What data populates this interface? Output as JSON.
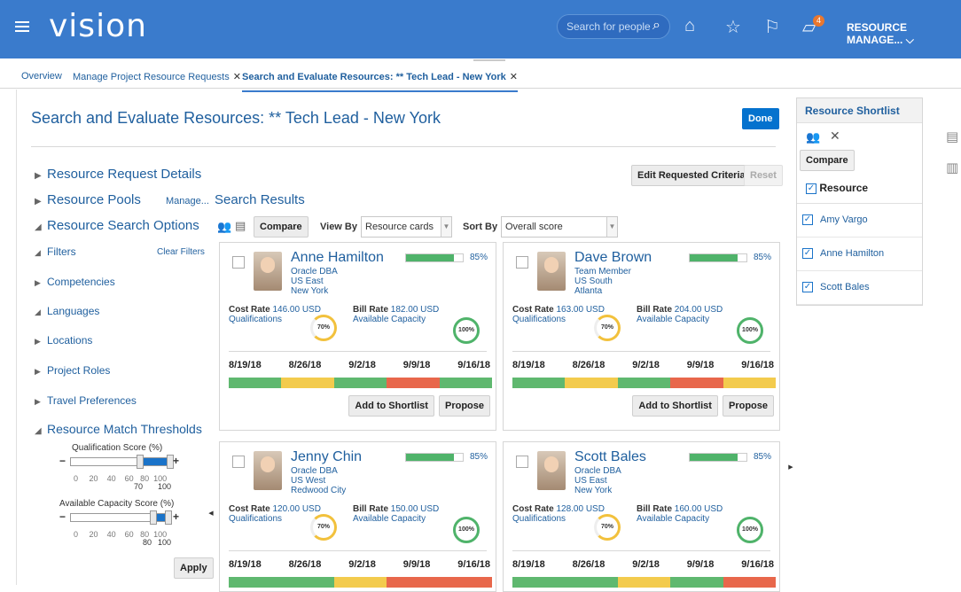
{
  "header": {
    "brand": "vision",
    "people_search_placeholder": "Search for people",
    "notification_count": "4",
    "user_menu": "RESOURCE MANAGE..."
  },
  "tabs": [
    {
      "label": "Overview"
    },
    {
      "label": "Manage Project Resource Requests"
    },
    {
      "label": "Search and Evaluate Resources: ** Tech Lead - New York"
    }
  ],
  "main": {
    "title": "Search and Evaluate Resources: ** Tech Lead - New York",
    "done": "Done",
    "sections": {
      "request_details": "Resource Request Details",
      "pools": "Resource Pools",
      "manage": "Manage...",
      "search_results": "Search Results",
      "search_options": "Resource Search Options"
    },
    "edit_criteria": "Edit Requested Criteria",
    "reset": "Reset",
    "compare": "Compare",
    "view_by_label": "View By",
    "view_by_value": "Resource cards",
    "sort_by_label": "Sort By",
    "sort_by_value": "Overall score"
  },
  "filters": {
    "title": "Filters",
    "clear": "Clear Filters",
    "items": [
      "Competencies",
      "Languages",
      "Locations",
      "Project Roles",
      "Travel Preferences"
    ],
    "thresholds_title": "Resource Match Thresholds",
    "qual_label": "Qualification Score (%)",
    "qual_min": "70",
    "qual_max": "100",
    "avail_label": "Available Capacity Score (%)",
    "avail_min": "80",
    "avail_max": "100",
    "ticks": [
      "0",
      "20",
      "40",
      "60",
      "80",
      "100"
    ],
    "apply": "Apply"
  },
  "cards": [
    {
      "name": "Anne Hamilton",
      "role": "Oracle DBA",
      "region": "US East",
      "city": "New York",
      "score": "85%",
      "cost_rate": "146.00 USD",
      "bill_rate": "182.00 USD",
      "qual_pct": "70%",
      "avail_pct": "100%",
      "calendar": [
        "g",
        "y",
        "g",
        "r",
        "g"
      ]
    },
    {
      "name": "Dave Brown",
      "role": "Team Member",
      "region": "US South",
      "city": "Atlanta",
      "score": "85%",
      "cost_rate": "163.00 USD",
      "bill_rate": "204.00 USD",
      "qual_pct": "70%",
      "avail_pct": "100%",
      "calendar": [
        "g",
        "y",
        "g",
        "r",
        "y"
      ]
    },
    {
      "name": "Jenny Chin",
      "role": "Oracle DBA",
      "region": "US West",
      "city": "Redwood City",
      "score": "85%",
      "cost_rate": "120.00 USD",
      "bill_rate": "150.00 USD",
      "qual_pct": "70%",
      "avail_pct": "100%",
      "calendar": [
        "g",
        "g",
        "y",
        "r",
        "r"
      ]
    },
    {
      "name": "Scott Bales",
      "role": "Oracle DBA",
      "region": "US East",
      "city": "New York",
      "score": "85%",
      "cost_rate": "128.00 USD",
      "bill_rate": "160.00 USD",
      "qual_pct": "70%",
      "avail_pct": "100%",
      "calendar": [
        "g",
        "g",
        "y",
        "g",
        "r"
      ]
    }
  ],
  "card_labels": {
    "cost_rate": "Cost Rate",
    "bill_rate": "Bill Rate",
    "qualifications": "Qualifications",
    "available_capacity": "Available Capacity",
    "dates": [
      "8/19/18",
      "8/26/18",
      "9/2/18",
      "9/9/18",
      "9/16/18"
    ],
    "add_shortlist": "Add to Shortlist",
    "propose": "Propose"
  },
  "shortlist": {
    "title": "Resource Shortlist",
    "compare": "Compare",
    "column": "Resource",
    "items": [
      "Amy Vargo",
      "Anne Hamilton",
      "Scott Bales"
    ]
  },
  "colors": {
    "header": "#3a7bcc",
    "link": "#1f5f9e",
    "green": "#5fb86f",
    "yellow": "#f3cb4d",
    "red": "#e8674b",
    "accent": "#0572ce"
  }
}
